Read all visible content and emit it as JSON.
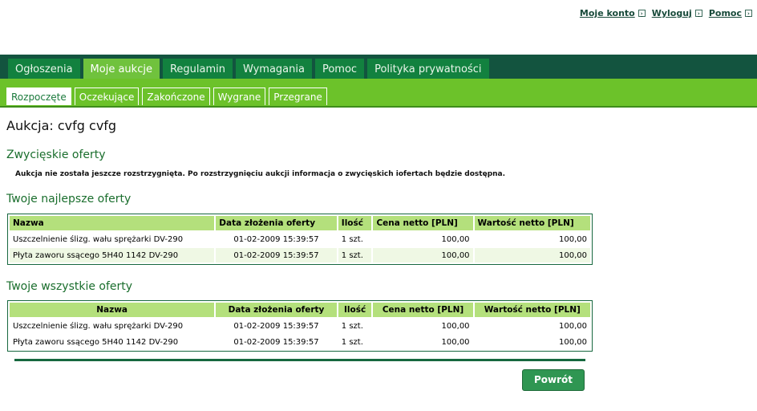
{
  "toplinks": [
    {
      "label": "Moje konto"
    },
    {
      "label": "Wyloguj"
    },
    {
      "label": "Pomoc"
    }
  ],
  "main_tabs": [
    {
      "label": "Ogłoszenia"
    },
    {
      "label": "Moje aukcje"
    },
    {
      "label": "Regulamin"
    },
    {
      "label": "Wymagania"
    },
    {
      "label": "Pomoc"
    },
    {
      "label": "Polityka prywatności"
    }
  ],
  "sub_tabs": [
    {
      "label": "Rozpoczęte"
    },
    {
      "label": "Oczekujące"
    },
    {
      "label": "Zakończone"
    },
    {
      "label": "Wygrane"
    },
    {
      "label": "Przegrane"
    }
  ],
  "page_title": "Aukcja: cvfg cvfg",
  "sections": {
    "winning": "Zwycięskie oferty",
    "winning_note": "Aukcja nie została jeszcze rozstrzygnięta. Po rozstrzygnięciu aukcji informacja o zwycięskich iofertach będzie dostępna.",
    "best": "Twoje najlepsze oferty",
    "all": "Twoje wszystkie oferty"
  },
  "columns": [
    "Nazwa",
    "Data złożenia oferty",
    "Ilość",
    "Cena netto [PLN]",
    "Wartość netto [PLN]"
  ],
  "best_offers": [
    [
      "Uszczelnienie ślizg. wału sprężarki DV-290",
      "01-02-2009 15:39:57",
      "1 szt.",
      "100,00",
      "100,00"
    ],
    [
      "Płyta zaworu ssącego 5H40 1142 DV-290",
      "01-02-2009 15:39:57",
      "1 szt.",
      "100,00",
      "100,00"
    ]
  ],
  "all_offers": [
    [
      "Uszczelnienie ślizg. wału sprężarki DV-290",
      "01-02-2009 15:39:57",
      "1 szt.",
      "100,00",
      "100,00"
    ],
    [
      "Płyta zaworu ssącego 5H40 1142 DV-290",
      "01-02-2009 15:39:57",
      "1 szt.",
      "100,00",
      "100,00"
    ]
  ],
  "back_button": "Powrót",
  "colors": {
    "dark_green": "#13543f",
    "tab_green": "#12813f",
    "light_green": "#6cc22a",
    "header_cell": "#b4e07c"
  }
}
